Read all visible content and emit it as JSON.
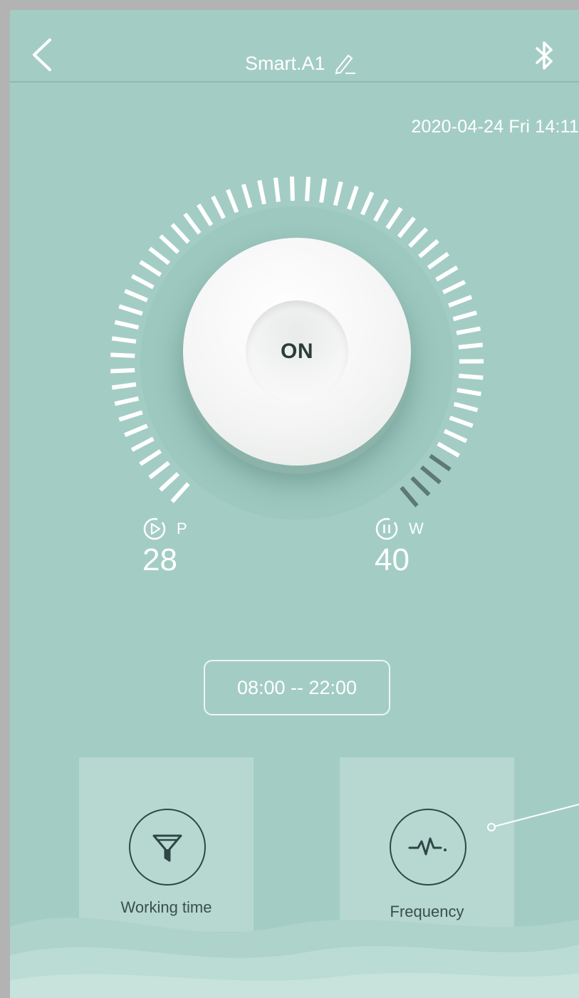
{
  "header": {
    "title": "Smart.A1",
    "back_icon": "chevron-left-icon",
    "edit_icon": "pencil-icon",
    "bluetooth_icon": "bluetooth-icon"
  },
  "datetime": "2020-04-24 Fri 14:11",
  "knob": {
    "label": "ON"
  },
  "stats": {
    "p": {
      "letter": "P",
      "value": "28",
      "icon": "play-circle-icon"
    },
    "w": {
      "letter": "W",
      "value": "40",
      "icon": "pause-circle-icon"
    }
  },
  "schedule": {
    "range": "08:00 -- 22:00"
  },
  "cards": [
    {
      "label": "Working time",
      "icon": "funnel-icon"
    },
    {
      "label": "Frequency",
      "icon": "pulse-icon"
    }
  ],
  "colors": {
    "background": "#a3cdc4",
    "card": "#b6d8d1",
    "knob": "#f4f5f4",
    "dark_ticks": "#5e7a75"
  }
}
